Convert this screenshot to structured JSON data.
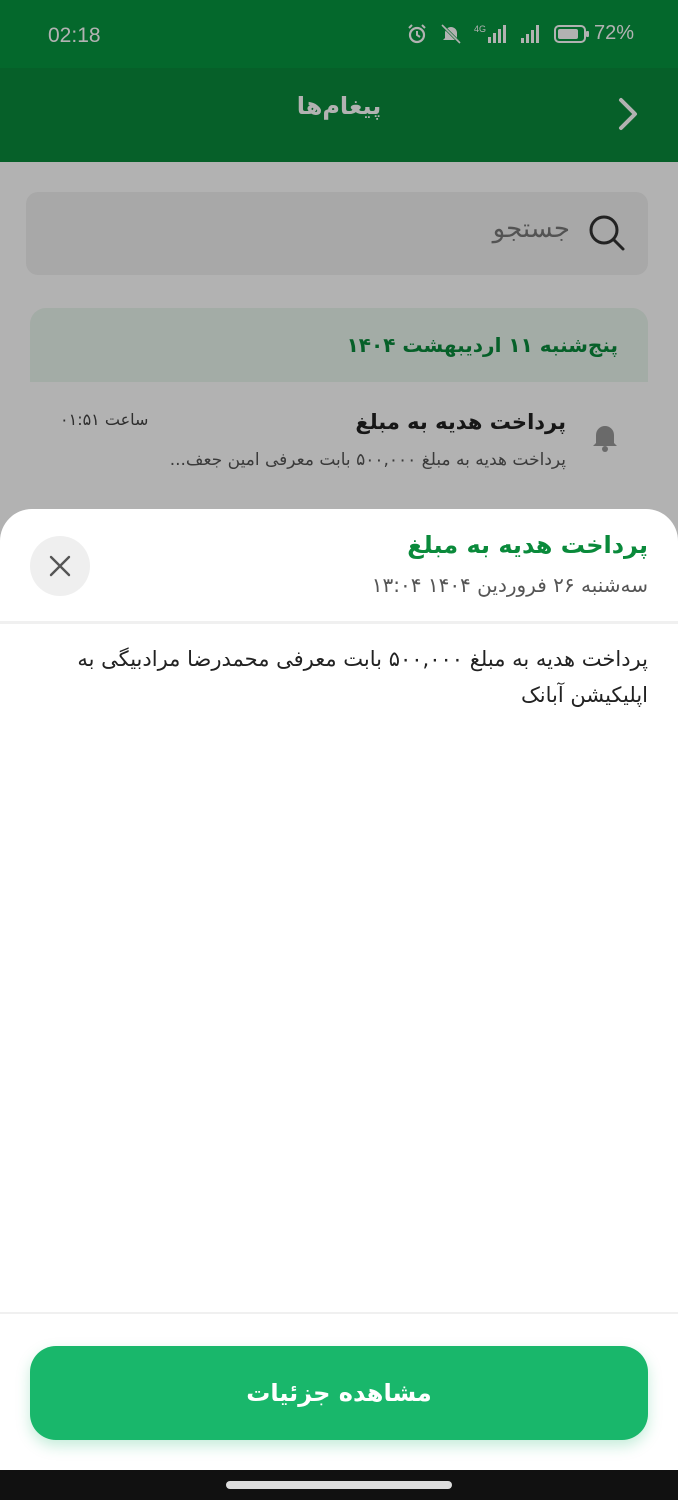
{
  "status_bar": {
    "time": "02:18",
    "battery": "72%",
    "network": "4G",
    "icons": [
      "alarm-icon",
      "bell-muted-icon",
      "signal-4g-icon",
      "signal-icon",
      "battery-icon"
    ]
  },
  "app_bar": {
    "title": "پیغام‌ها",
    "back_icon": "chevron-right-icon"
  },
  "search": {
    "placeholder": "جستجو"
  },
  "message_group": {
    "date": "پنج‌شنبه ۱۱ اردیبهشت ۱۴۰۴",
    "items": [
      {
        "title": "پرداخت هدیه به مبلغ",
        "snippet": "پرداخت هدیه به مبلغ ۵۰۰,۰۰۰ بابت معرفی امین جعف...",
        "time": "ساعت ۰۱:۵۱"
      }
    ]
  },
  "sheet": {
    "title": "پرداخت هدیه به مبلغ",
    "date": "سه‌شنبه ۲۶ فروردین ۱۴۰۴ ۱۳:۰۴",
    "body": "پرداخت هدیه به مبلغ ۵۰۰,۰۰۰ بابت معرفی محمدرضا مرادبیگی به اپلیکیشن آبانک",
    "button_label": "مشاهده جزئیات"
  },
  "colors": {
    "status_bar": "#079540",
    "app_bar": "#0a8a3b",
    "accent": "#0a8a3b",
    "button": "#19b76b"
  }
}
